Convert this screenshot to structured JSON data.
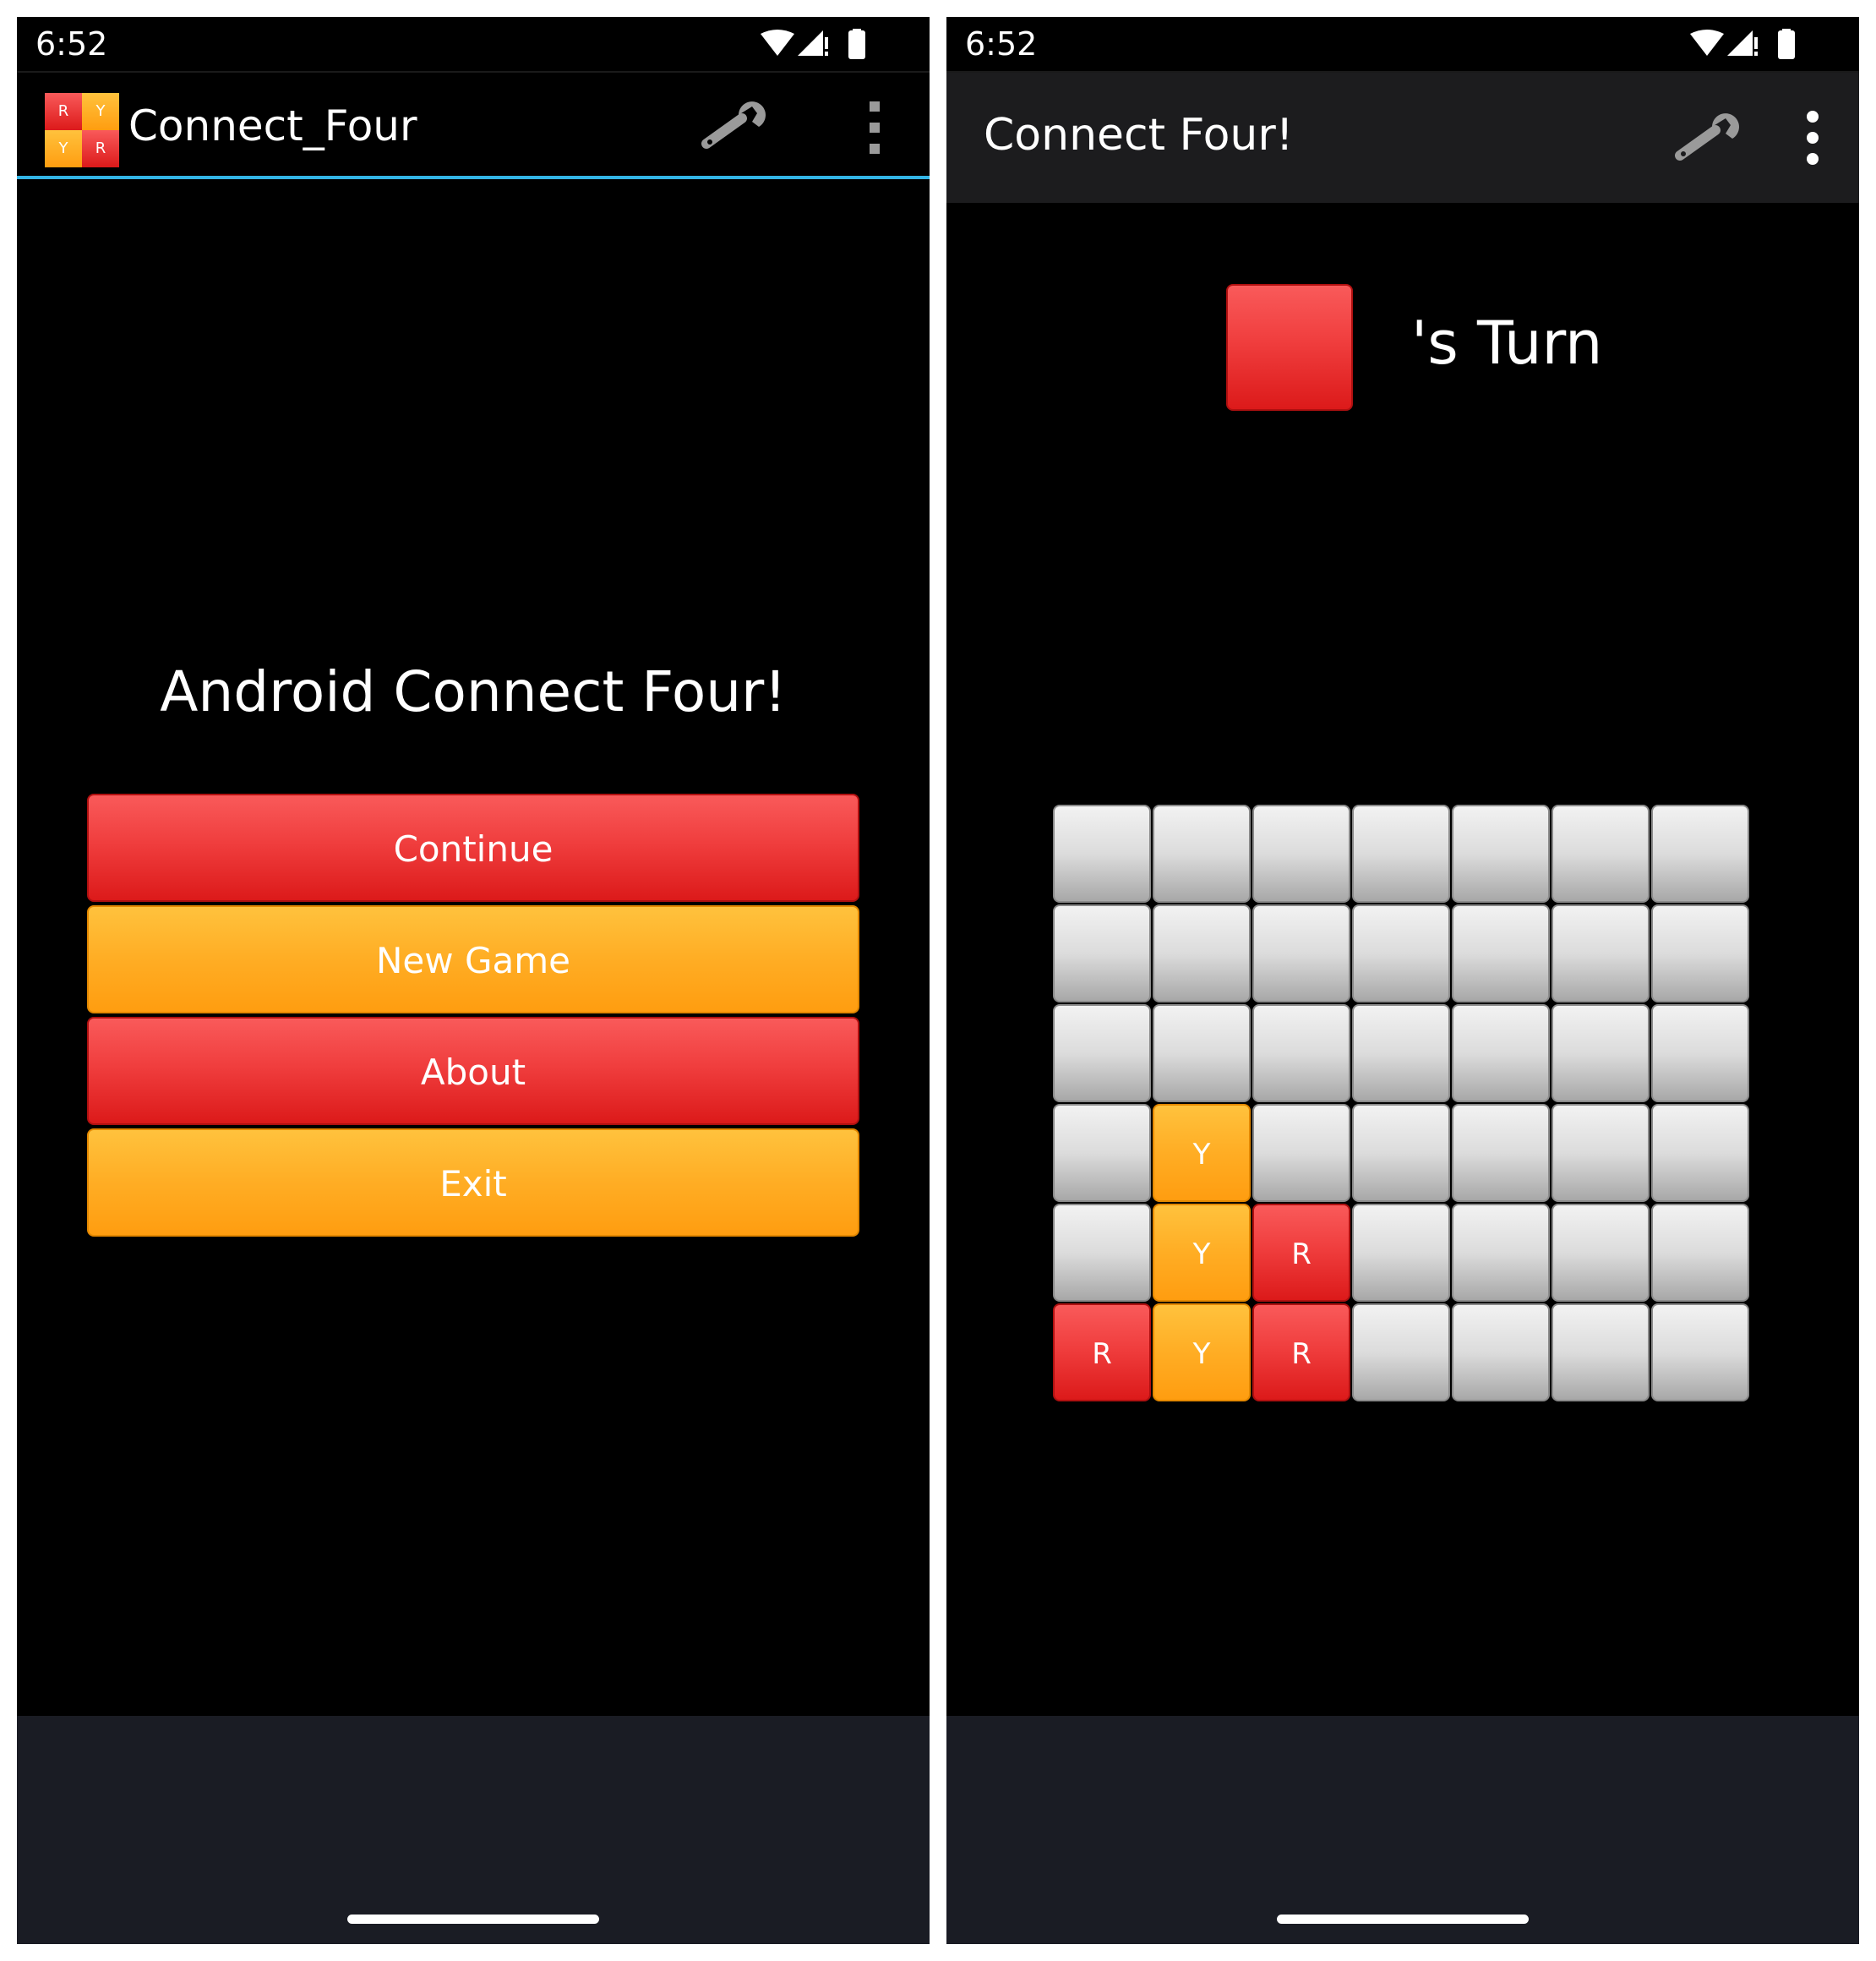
{
  "colors": {
    "accent_line": "#33b5e5",
    "red_piece": "#f03e3e",
    "yellow_piece": "#ffad24",
    "empty_cell": "#dcdcdc",
    "nav_bar": "#1a1c24",
    "toolbar_dark": "#1c1c1e"
  },
  "left": {
    "status_bar": {
      "time": "6:52",
      "icons": [
        "wifi-icon",
        "signal-icon",
        "battery-icon"
      ]
    },
    "appbar": {
      "logo_cells": [
        "R",
        "Y",
        "Y",
        "R"
      ],
      "title": "Connect_Four",
      "actions": [
        "wrench-icon",
        "overflow-menu-icon"
      ]
    },
    "welcome": "Android Connect Four!",
    "buttons": [
      {
        "label": "Continue",
        "color": "red"
      },
      {
        "label": "New Game",
        "color": "orange"
      },
      {
        "label": "About",
        "color": "red"
      },
      {
        "label": "Exit",
        "color": "orange"
      }
    ]
  },
  "right": {
    "status_bar": {
      "time": "6:52",
      "icons": [
        "wifi-icon",
        "signal-icon",
        "battery-icon"
      ]
    },
    "appbar": {
      "title": "Connect Four!",
      "actions": [
        "wrench-icon",
        "overflow-menu-icon"
      ]
    },
    "turn": {
      "piece": "R",
      "text": "'s Turn"
    },
    "board": {
      "columns": 7,
      "rows": 6,
      "cells": [
        [
          "",
          "",
          "",
          "",
          "",
          "",
          ""
        ],
        [
          "",
          "",
          "",
          "",
          "",
          "",
          ""
        ],
        [
          "",
          "",
          "",
          "",
          "",
          "",
          ""
        ],
        [
          "",
          "Y",
          "",
          "",
          "",
          "",
          ""
        ],
        [
          "",
          "Y",
          "R",
          "",
          "",
          "",
          ""
        ],
        [
          "R",
          "Y",
          "R",
          "",
          "",
          "",
          ""
        ]
      ]
    }
  }
}
